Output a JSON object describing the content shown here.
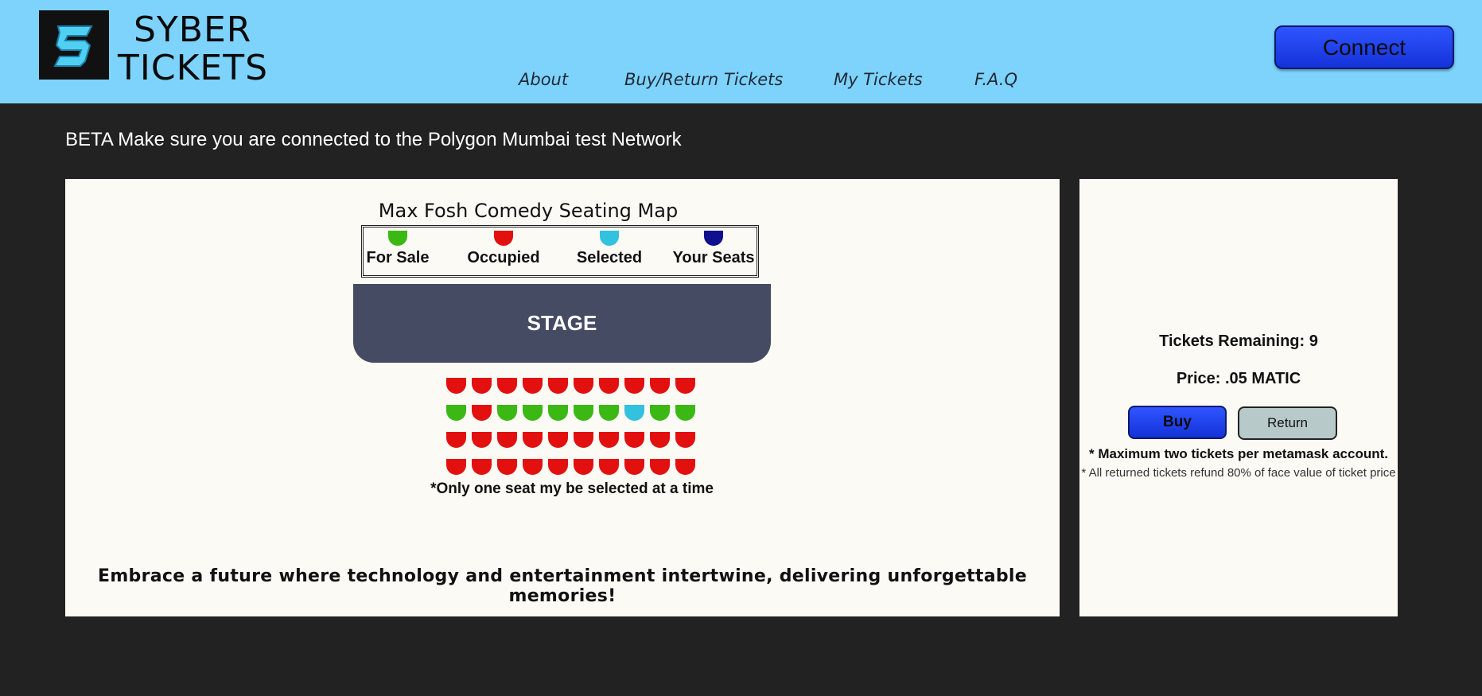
{
  "header": {
    "logo_glyph": "S",
    "brand_line1": "SYBER",
    "brand_line2": "TICKETS",
    "nav": [
      "About",
      "Buy/Return Tickets",
      "My Tickets",
      "F.A.Q"
    ],
    "connect_label": "Connect"
  },
  "intro": {
    "beta_notice": "BETA Make sure you are connected to the Polygon Mumbai test Network"
  },
  "seating_map": {
    "title": "Max Fosh Comedy Seating Map",
    "legend": [
      {
        "label": "For Sale",
        "color": "#3cb814"
      },
      {
        "label": "Occupied",
        "color": "#e31010"
      },
      {
        "label": "Selected",
        "color": "#33c1e0"
      },
      {
        "label": "Your Seats",
        "color": "#0f0f8f"
      }
    ],
    "stage_label": "STAGE",
    "rows": [
      [
        "occupied",
        "occupied",
        "occupied",
        "occupied",
        "occupied",
        "occupied",
        "occupied",
        "occupied",
        "occupied",
        "occupied"
      ],
      [
        "for_sale",
        "occupied",
        "for_sale",
        "for_sale",
        "for_sale",
        "for_sale",
        "for_sale",
        "selected",
        "for_sale",
        "for_sale"
      ],
      [
        "occupied",
        "occupied",
        "occupied",
        "occupied",
        "occupied",
        "occupied",
        "occupied",
        "occupied",
        "occupied",
        "occupied"
      ],
      [
        "occupied",
        "occupied",
        "occupied",
        "occupied",
        "occupied",
        "occupied",
        "occupied",
        "occupied",
        "occupied",
        "occupied"
      ]
    ],
    "note": "*Only one seat my be selected at a time",
    "tagline": "Embrace a future where technology and entertainment intertwine, delivering unforgettable memories!"
  },
  "purchase": {
    "remaining": "Tickets Remaining: 9",
    "price": "Price: .05 MATIC",
    "buy_label": "Buy",
    "return_label": "Return",
    "max_note": "* Maximum two tickets per metamask account.",
    "refund_note": "* All returned tickets refund 80% of face value of ticket price"
  },
  "colors": {
    "header_bg": "#7dd3fc",
    "page_bg": "#222222",
    "panel_bg": "#fbfaf4",
    "accent_blue": "#1f3ff0",
    "stage": "#454b63"
  }
}
